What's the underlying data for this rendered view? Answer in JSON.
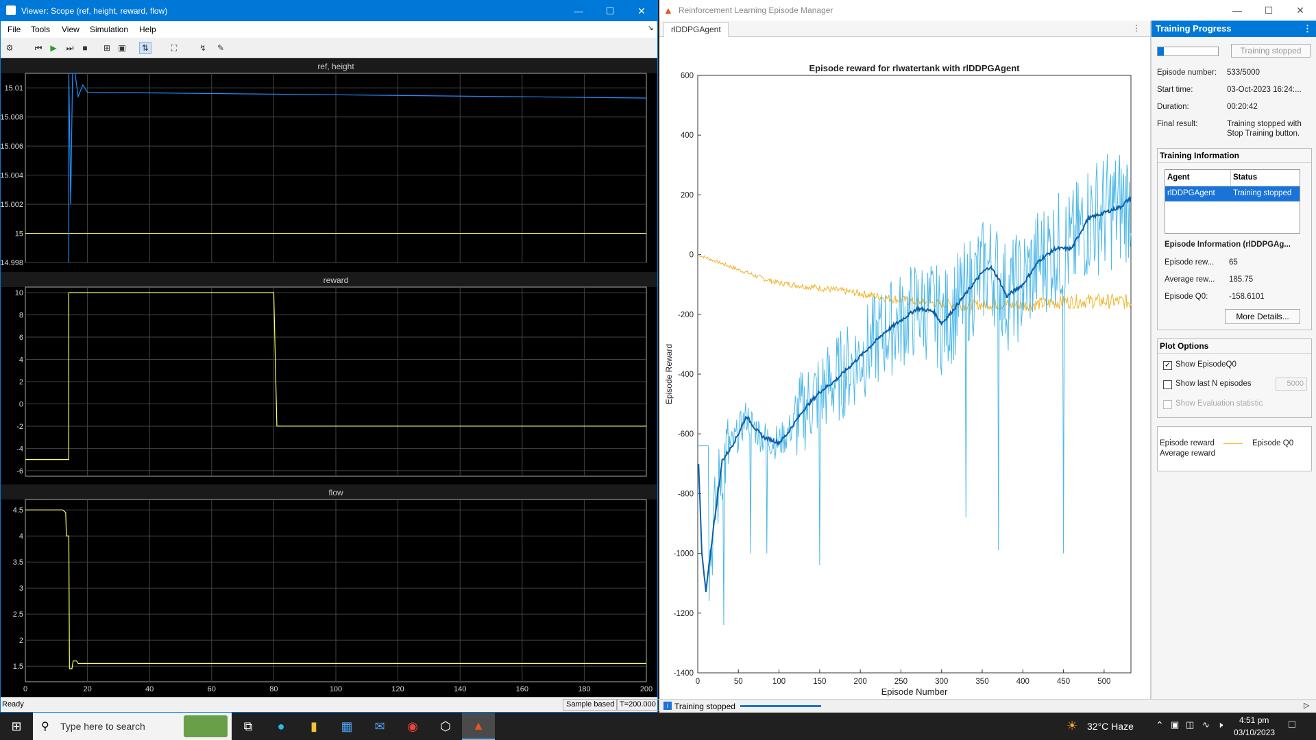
{
  "scope": {
    "title": "Viewer: Scope (ref, height, reward, flow)",
    "menu": [
      "File",
      "Tools",
      "View",
      "Simulation",
      "Help"
    ],
    "status": "Ready",
    "sample_mode": "Sample based",
    "time": "T=200.000",
    "plots": [
      {
        "title": "ref, height",
        "yticks": [
          "15.01",
          "15.008",
          "15.006",
          "15.004",
          "15.002",
          "15",
          "14.998"
        ]
      },
      {
        "title": "reward",
        "yticks": [
          "10",
          "8",
          "6",
          "4",
          "2",
          "0",
          "-2",
          "-4",
          "-6"
        ]
      },
      {
        "title": "flow",
        "yticks": [
          "4.5",
          "4",
          "3.5",
          "3",
          "2.5",
          "2",
          "1.5"
        ]
      }
    ],
    "xticks": [
      "0",
      "20",
      "40",
      "60",
      "80",
      "100",
      "120",
      "140",
      "160",
      "180",
      "200"
    ]
  },
  "manager": {
    "title": "Reinforcement Learning Episode Manager",
    "tab": "rlDDPGAgent",
    "status": "Training stopped",
    "progress": {
      "header": "Training Progress",
      "stop_button": "Training stopped",
      "episode_number_label": "Episode number:",
      "episode_number": "533/5000",
      "start_time_label": "Start time:",
      "start_time": "03-Oct-2023 16:24:...",
      "duration_label": "Duration:",
      "duration": "00:20:42",
      "final_result_label": "Final result:",
      "final_result_line1": "Training stopped with",
      "final_result_line2": "Stop Training button.",
      "fraction_complete": 0.107
    },
    "training_info": {
      "header": "Training Information",
      "columns": [
        "Agent",
        "Status"
      ],
      "agent": "rlDDPGAgent",
      "status": "Training stopped",
      "episode_info_header": "Episode Information (rlDDPGAg...",
      "episode_reward_label": "Episode rew...",
      "episode_reward": "65",
      "average_reward_label": "Average rew...",
      "average_reward": "185.75",
      "episode_q0_label": "Episode Q0:",
      "episode_q0": "-158.6101",
      "more_details": "More Details..."
    },
    "plot_options": {
      "header": "Plot Options",
      "show_q0": "Show EpisodeQ0",
      "show_last_n": "Show last N episodes",
      "last_n_value": "5000",
      "show_eval": "Show Evaluation statistic"
    },
    "legend": {
      "episode_reward": "Episode reward",
      "average_reward": "Average reward",
      "episode_q0": "Episode Q0"
    }
  },
  "taskbar": {
    "search_placeholder": "Type here to search",
    "weather": "32°C  Haze",
    "time": "4:51 pm",
    "date": "03/10/2023"
  },
  "colors": {
    "scope_yellow": "#ffff66",
    "scope_blue": "#1e90ff",
    "episode_reward": "#4db8e8",
    "average_reward": "#0a5fa8",
    "episode_q0": "#f0b429",
    "accent": "#0078d7"
  },
  "chart_data": {
    "type": "line",
    "title": "Episode reward for rlwatertank with rlDDPGAgent",
    "xlabel": "Episode Number",
    "ylabel": "Episode Reward",
    "xlim": [
      0,
      533
    ],
    "ylim": [
      -1400,
      600
    ],
    "xticks": [
      0,
      50,
      100,
      150,
      200,
      250,
      300,
      350,
      400,
      450,
      500
    ],
    "yticks": [
      600,
      400,
      200,
      0,
      -200,
      -400,
      -600,
      -800,
      -1000,
      -1200,
      -1400
    ],
    "series": [
      {
        "name": "Average reward",
        "x": [
          0,
          5,
          10,
          20,
          30,
          40,
          50,
          60,
          70,
          80,
          90,
          100,
          110,
          120,
          130,
          150,
          170,
          200,
          230,
          250,
          270,
          290,
          300,
          310,
          330,
          350,
          360,
          370,
          380,
          400,
          420,
          440,
          460,
          480,
          500,
          520,
          533
        ],
        "y": [
          -620,
          -1000,
          -1130,
          -900,
          -690,
          -650,
          -600,
          -540,
          -580,
          -610,
          -620,
          -630,
          -600,
          -560,
          -520,
          -460,
          -420,
          -340,
          -260,
          -220,
          -180,
          -190,
          -230,
          -200,
          -130,
          -60,
          -40,
          -80,
          -140,
          -100,
          -20,
          20,
          20,
          120,
          140,
          160,
          190
        ]
      },
      {
        "name": "Episode Q0",
        "x": [
          0,
          20,
          40,
          60,
          80,
          100,
          130,
          160,
          200,
          230,
          260,
          300,
          330,
          360,
          400,
          440,
          480,
          533
        ],
        "y": [
          0,
          -20,
          -40,
          -60,
          -80,
          -95,
          -105,
          -115,
          -130,
          -145,
          -155,
          -165,
          -170,
          -165,
          -170,
          -160,
          -155,
          -158
        ]
      }
    ]
  }
}
